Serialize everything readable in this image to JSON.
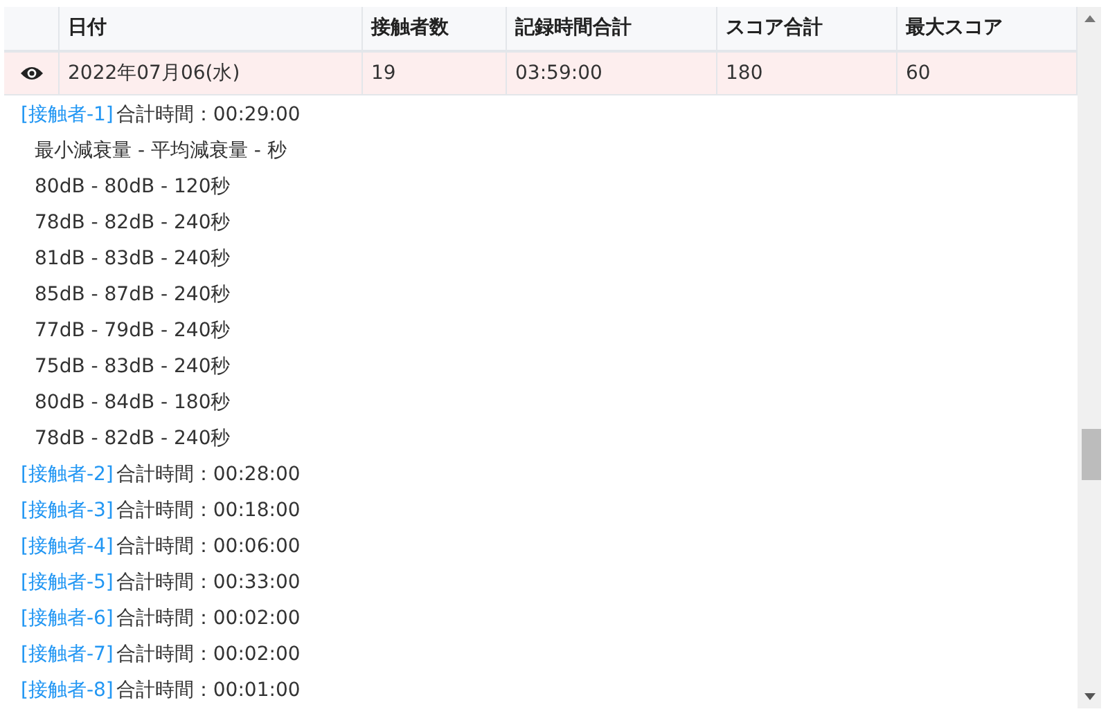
{
  "table": {
    "columns": [
      "日付",
      "接触者数",
      "記録時間合計",
      "スコア合計",
      "最大スコア"
    ],
    "rows": [
      {
        "selected": true,
        "cells": [
          "2022年07月06(水)",
          "19",
          "03:59:00",
          "180",
          "60"
        ]
      }
    ]
  },
  "contacts": [
    {
      "tag": "[接触者-1]",
      "total": "合計時間：00:29:00",
      "expanded": true,
      "header": "最小減衰量 - 平均減衰量 - 秒",
      "details": [
        "80dB - 80dB - 120秒",
        "78dB - 82dB - 240秒",
        "81dB - 83dB - 240秒",
        "85dB - 87dB - 240秒",
        "77dB - 79dB - 240秒",
        "75dB - 83dB - 240秒",
        "80dB - 84dB - 180秒",
        "78dB - 82dB - 240秒"
      ]
    },
    {
      "tag": "[接触者-2]",
      "total": "合計時間：00:28:00",
      "expanded": false
    },
    {
      "tag": "[接触者-3]",
      "total": "合計時間：00:18:00",
      "expanded": false
    },
    {
      "tag": "[接触者-4]",
      "total": "合計時間：00:06:00",
      "expanded": false
    },
    {
      "tag": "[接触者-5]",
      "total": "合計時間：00:33:00",
      "expanded": false
    },
    {
      "tag": "[接触者-6]",
      "total": "合計時間：00:02:00",
      "expanded": false
    },
    {
      "tag": "[接触者-7]",
      "total": "合計時間：00:02:00",
      "expanded": false
    },
    {
      "tag": "[接触者-8]",
      "total": "合計時間：00:01:00",
      "expanded": false
    }
  ]
}
